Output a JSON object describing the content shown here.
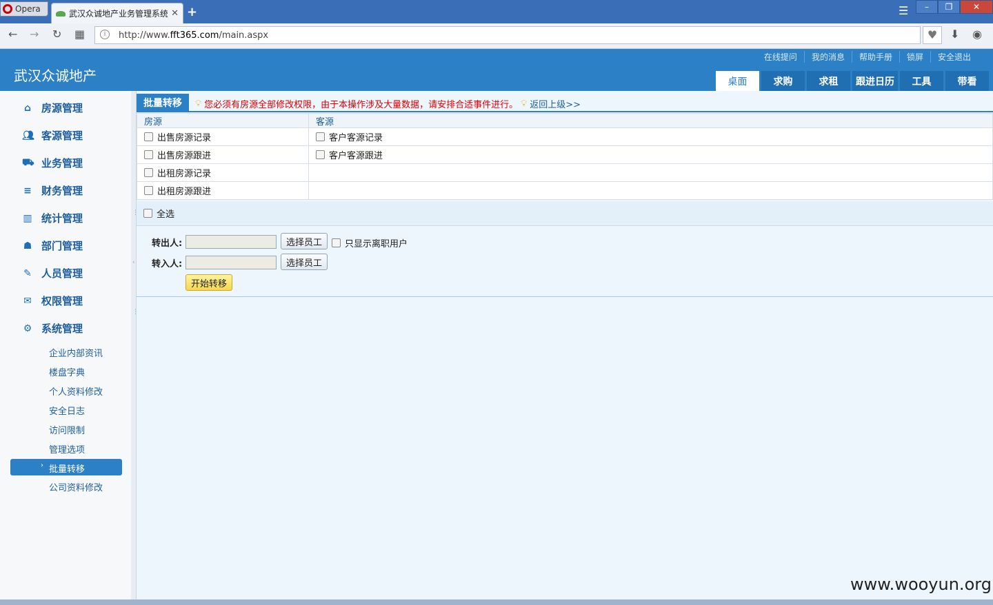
{
  "browser": {
    "menu_label": "Opera",
    "tab_title": "武汉众诚地产业务管理系统",
    "tab_close": "✕",
    "new_tab": "+",
    "address": {
      "prefix": "http://www.",
      "domain": "fft365.com",
      "path": "/main.aspx"
    },
    "window_controls": {
      "minimize": "–",
      "restore": "❐",
      "close": "✕"
    },
    "icons": [
      "back-icon",
      "forward-icon",
      "reload-icon",
      "speed-dial-icon",
      "security-icon",
      "heart-icon",
      "download-icon",
      "account-icon"
    ]
  },
  "app": {
    "brand": "武汉众诚地产",
    "top_links": [
      "在线提问",
      "我的消息",
      "帮助手册",
      "锁屏",
      "安全退出"
    ],
    "top_nav": [
      "桌面",
      "求购",
      "求租",
      "跟进日历",
      "工具",
      "带看"
    ],
    "top_nav_active": "桌面"
  },
  "sidebar": {
    "menu": [
      {
        "label": "房源管理",
        "icon": "home-icon"
      },
      {
        "label": "客源管理",
        "icon": "users-icon"
      },
      {
        "label": "业务管理",
        "icon": "car-icon"
      },
      {
        "label": "财务管理",
        "icon": "finance-icon"
      },
      {
        "label": "统计管理",
        "icon": "chart-icon"
      },
      {
        "label": "部门管理",
        "icon": "org-icon"
      },
      {
        "label": "人员管理",
        "icon": "clip-icon"
      },
      {
        "label": "权限管理",
        "icon": "chat-icon"
      },
      {
        "label": "系统管理",
        "icon": "gear-icon"
      }
    ],
    "sub_items": [
      "企业内部资讯",
      "楼盘字典",
      "个人资料修改",
      "安全日志",
      "访问限制",
      "管理选项",
      "批量转移",
      "公司资料修改"
    ],
    "active_sub": "批量转移"
  },
  "main": {
    "title": "批量转移",
    "warning": "您必须有房源全部修改权限，由于本操作涉及大量数据，请安排合适事件进行。",
    "back_link": "返回上级>>",
    "columns": [
      "房源",
      "客源"
    ],
    "rows": [
      [
        "出售房源记录",
        "客户客源记录"
      ],
      [
        "出售房源跟进",
        "客户客源跟进"
      ],
      [
        "出租房源记录",
        ""
      ],
      [
        "出租房源跟进",
        ""
      ]
    ],
    "select_all": "全选",
    "form": {
      "from_label": "转出人:",
      "to_label": "转入人:",
      "from_value": "",
      "to_value": "",
      "choose_btn": "选择员工",
      "only_left_label": "只显示离职用户",
      "start_btn": "开始转移"
    }
  },
  "watermark": "www.wooyun.org"
}
